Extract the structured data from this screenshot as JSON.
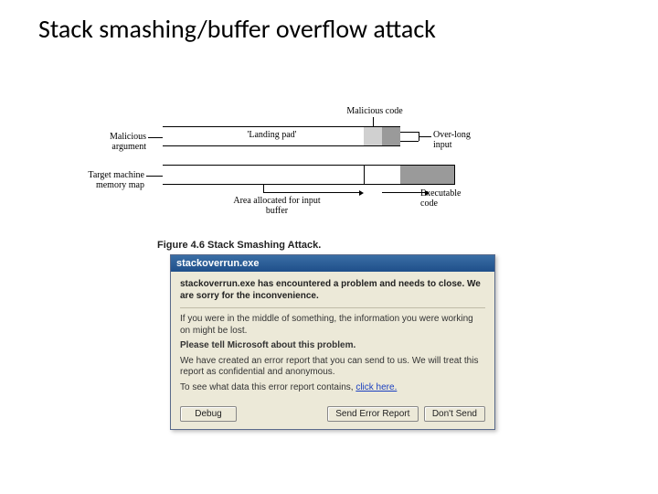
{
  "slide": {
    "title": "Stack smashing/buffer overflow attack"
  },
  "diagram": {
    "labels": {
      "malicious_argument": "Malicious\nargument",
      "malicious_code": "Malicious code",
      "landing_pad": "'Landing pad'",
      "overlong_input": "Over-long\ninput",
      "target_machine_memory_map": "Target machine\nmemory map",
      "area_allocated": "Area allocated for\ninput buffer",
      "executable_code": "Executable\ncode"
    },
    "figure_caption": "Figure 4.6 Stack Smashing Attack."
  },
  "dialog": {
    "title": "stackoverrun.exe",
    "main_message": "stackoverrun.exe has encountered a problem and needs to close.  We are sorry for the inconvenience.",
    "info_lost": "If you were in the middle of something, the information you were working on might be lost.",
    "tell_heading": "Please tell Microsoft about this problem.",
    "tell_body": "We have created an error report that you can send to us. We will treat this report as confidential and anonymous.",
    "see_prefix": "To see what data this error report contains, ",
    "see_link": "click here.",
    "buttons": {
      "debug": "Debug",
      "send": "Send Error Report",
      "dont_send": "Don't Send"
    }
  }
}
